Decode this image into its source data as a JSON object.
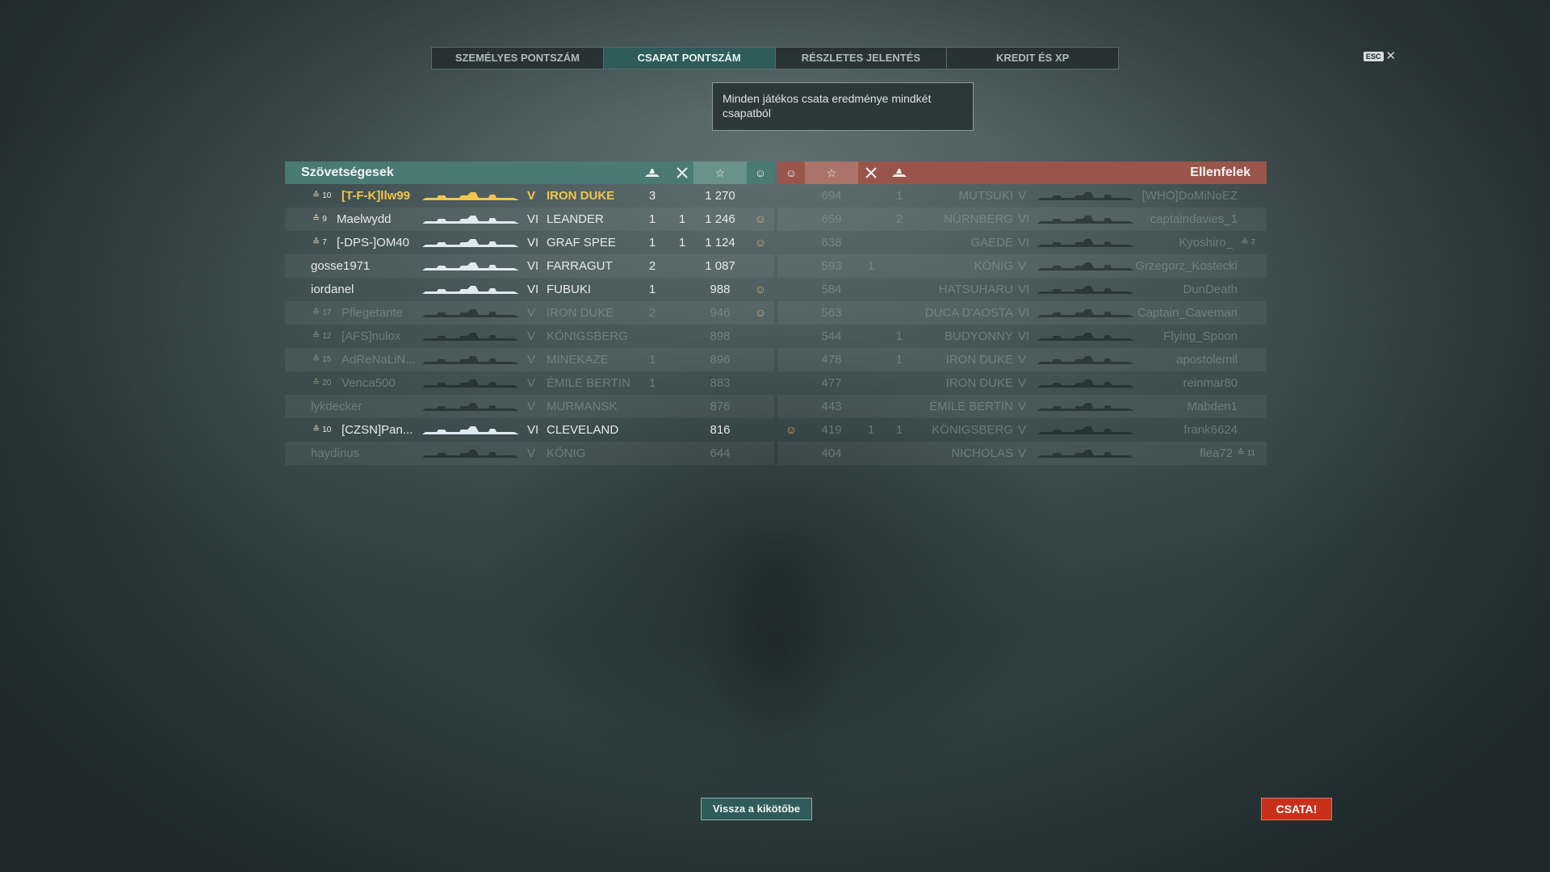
{
  "tabs": [
    {
      "label": "SZEMÉLYES PONTSZÁM",
      "active": false
    },
    {
      "label": "CSAPAT PONTSZÁM",
      "active": true
    },
    {
      "label": "RÉSZLETES JELENTÉS",
      "active": false
    },
    {
      "label": "KREDIT ÉS XP",
      "active": false
    }
  ],
  "esc": {
    "label": "ESC",
    "close_glyph": "✕"
  },
  "tooltip": {
    "text": "Minden játékos csata eredménye mindkét csapatból"
  },
  "allies": {
    "title": "Szövetségesek",
    "rows": [
      {
        "rank": "10",
        "name": "[T-F-K]llw99",
        "tier": "V",
        "ship": "IRON DUKE",
        "c1": "3",
        "c2": "",
        "score": "1 270",
        "medal": false,
        "me": true,
        "dead": false
      },
      {
        "rank": "9",
        "name": "Maelwydd",
        "tier": "VI",
        "ship": "LEANDER",
        "c1": "1",
        "c2": "1",
        "score": "1 246",
        "medal": true,
        "me": false,
        "dead": false
      },
      {
        "rank": "7",
        "name": "[-DPS-]OM40",
        "tier": "VI",
        "ship": "GRAF SPEE",
        "c1": "1",
        "c2": "1",
        "score": "1 124",
        "medal": true,
        "me": false,
        "dead": false
      },
      {
        "rank": "",
        "name": "gosse1971",
        "tier": "VI",
        "ship": "FARRAGUT",
        "c1": "2",
        "c2": "",
        "score": "1 087",
        "medal": false,
        "me": false,
        "dead": false
      },
      {
        "rank": "",
        "name": "iordanel",
        "tier": "VI",
        "ship": "FUBUKI",
        "c1": "1",
        "c2": "",
        "score": "988",
        "medal": true,
        "me": false,
        "dead": false
      },
      {
        "rank": "17",
        "name": "Pflegetante",
        "tier": "V",
        "ship": "IRON DUKE",
        "c1": "2",
        "c2": "",
        "score": "946",
        "medal": true,
        "me": false,
        "dead": true
      },
      {
        "rank": "12",
        "name": "[AFS]nulox",
        "tier": "V",
        "ship": "KÖNIGSBERG",
        "c1": "",
        "c2": "",
        "score": "898",
        "medal": false,
        "me": false,
        "dead": true
      },
      {
        "rank": "15",
        "name": "AdReNaLiN...",
        "tier": "V",
        "ship": "MINEKAZE",
        "c1": "1",
        "c2": "",
        "score": "896",
        "medal": false,
        "me": false,
        "dead": true
      },
      {
        "rank": "20",
        "name": "Venca500",
        "tier": "V",
        "ship": "ÉMILE BERTIN",
        "c1": "1",
        "c2": "",
        "score": "883",
        "medal": false,
        "me": false,
        "dead": true
      },
      {
        "rank": "",
        "name": "lykdecker",
        "tier": "V",
        "ship": "MURMANSK",
        "c1": "",
        "c2": "",
        "score": "876",
        "medal": false,
        "me": false,
        "dead": true
      },
      {
        "rank": "10",
        "name": "[CZSN]Pan...",
        "tier": "VI",
        "ship": "CLEVELAND",
        "c1": "",
        "c2": "",
        "score": "816",
        "medal": false,
        "me": false,
        "dead": false
      },
      {
        "rank": "",
        "name": "haydinus",
        "tier": "V",
        "ship": "KÖNIG",
        "c1": "",
        "c2": "",
        "score": "644",
        "medal": false,
        "me": false,
        "dead": true
      }
    ]
  },
  "enemies": {
    "title": "Ellenfelek",
    "rows": [
      {
        "rank": "",
        "name": "[WHO]DoMiNoEZ",
        "tier": "V",
        "ship": "MUTSUKI",
        "c1": "",
        "c2": "1",
        "score": "694",
        "medal": false,
        "dead": true
      },
      {
        "rank": "",
        "name": "captaindavies_1",
        "tier": "VI",
        "ship": "NÜRNBERG",
        "c1": "",
        "c2": "2",
        "score": "659",
        "medal": false,
        "dead": true
      },
      {
        "rank": "7",
        "name": "Kyoshiro_",
        "tier": "VI",
        "ship": "GAEDE",
        "c1": "",
        "c2": "",
        "score": "638",
        "medal": false,
        "dead": true
      },
      {
        "rank": "",
        "name": "Grzegorz_Kostecki",
        "tier": "V",
        "ship": "KÖNIG",
        "c1": "1",
        "c2": "",
        "score": "593",
        "medal": false,
        "dead": true
      },
      {
        "rank": "",
        "name": "DunDeath",
        "tier": "VI",
        "ship": "HATSUHARU",
        "c1": "",
        "c2": "",
        "score": "584",
        "medal": false,
        "dead": true
      },
      {
        "rank": "",
        "name": "Captain_Caveman",
        "tier": "VI",
        "ship": "DUCA D'AOSTA",
        "c1": "",
        "c2": "",
        "score": "563",
        "medal": false,
        "dead": true
      },
      {
        "rank": "",
        "name": "Flying_Spoon",
        "tier": "VI",
        "ship": "BUDYONNY",
        "c1": "",
        "c2": "1",
        "score": "544",
        "medal": false,
        "dead": true
      },
      {
        "rank": "",
        "name": "apostolemil",
        "tier": "V",
        "ship": "IRON DUKE",
        "c1": "",
        "c2": "1",
        "score": "478",
        "medal": false,
        "dead": true
      },
      {
        "rank": "",
        "name": "reinmar80",
        "tier": "V",
        "ship": "IRON DUKE",
        "c1": "",
        "c2": "",
        "score": "477",
        "medal": false,
        "dead": true
      },
      {
        "rank": "",
        "name": "Mabden1",
        "tier": "V",
        "ship": "ÉMILE BERTIN",
        "c1": "",
        "c2": "",
        "score": "443",
        "medal": false,
        "dead": true
      },
      {
        "rank": "",
        "name": "frank6624",
        "tier": "V",
        "ship": "KÖNIGSBERG",
        "c1": "1",
        "c2": "1",
        "score": "419",
        "medal": true,
        "dead": true
      },
      {
        "rank": "11",
        "name": "flea72",
        "tier": "V",
        "ship": "NICHOLAS",
        "c1": "",
        "c2": "",
        "score": "404",
        "medal": false,
        "dead": true
      }
    ]
  },
  "buttons": {
    "port": "Vissza a kikötőbe",
    "battle": "CSATA!"
  },
  "colors": {
    "allies_header": "#4a7a74",
    "enemies_header": "#9a554b",
    "active_tab": "#2f5b5b",
    "battle_button": "#c8301c",
    "player_highlight": "#f0c64a"
  }
}
